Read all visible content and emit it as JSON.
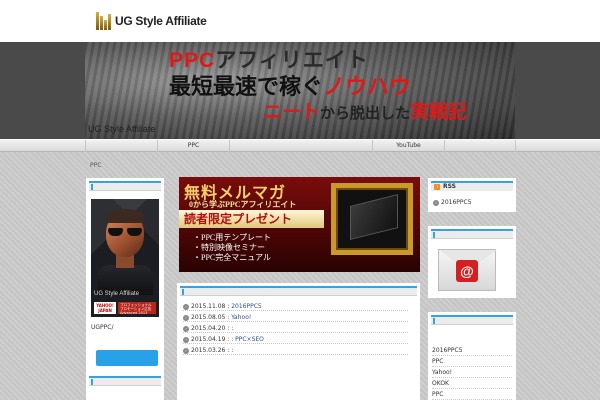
{
  "header": {
    "logo_text": "UG Style Affiliate"
  },
  "banner": {
    "line1_accent": "PPC",
    "line1_rest": "アフィリエイト",
    "line2_main": "最短最速で稼ぐ",
    "line2_accent": "ノウハウ",
    "line3_accent": "ニート",
    "line3_mid": "から脱出した",
    "line3_end": "実戦記",
    "subtitle": "UG Style Affiliate"
  },
  "nav": {
    "items": [
      {
        "label": ""
      },
      {
        "label": "PPC"
      },
      {
        "label": ""
      },
      {
        "label": "YouTube"
      },
      {
        "label": ""
      }
    ]
  },
  "breadcrumb": {
    "text": "PPC"
  },
  "profile": {
    "name_overlay": "UG Style Affiliate",
    "badge_left": "YAHOO! JAPAN",
    "badge_right": "プロフェッショナル プロモーション広告 Advanced 2013",
    "label": "UGPPC/"
  },
  "mailmag": {
    "title": "無料メルマガ",
    "subtitle": "0から学ぶPPCアフィリエイト",
    "band": "読者限定プレゼント",
    "list": [
      "・PPC用テンプレート",
      "・特別映像セミナー",
      "・PPC完全マニュアル"
    ]
  },
  "posts": [
    {
      "date": "2015.11.08",
      "sep": " : ",
      "title": "2016PPC5"
    },
    {
      "date": "2015.08.05",
      "sep": " : ",
      "title": "Yahoo!"
    },
    {
      "date": "2015.04.20",
      "sep": " : : ",
      "title": ""
    },
    {
      "date": "2015.04.19",
      "sep": " : : ",
      "title": "PPC×SEO"
    },
    {
      "date": "2015.03.26",
      "sep": " : : ",
      "title": ""
    }
  ],
  "rss": {
    "title": "RSS",
    "item": "2016PPC5"
  },
  "categories": [
    "2016PPC5",
    "PPC",
    "Yahoo!",
    "OKOK",
    "PPC"
  ],
  "colors": {
    "accent": "#36a2e6",
    "banner_red": "#e01818",
    "mailmag_bg": "#7a0c0c"
  }
}
